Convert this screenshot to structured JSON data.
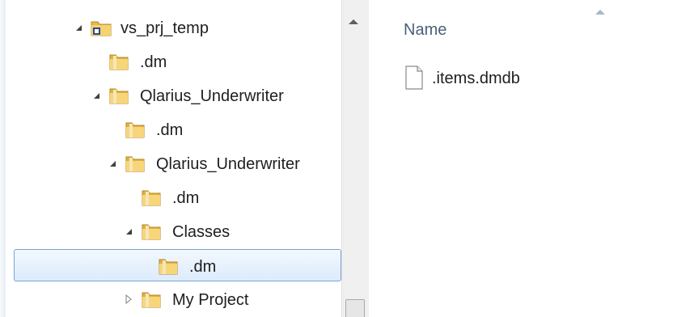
{
  "nav_tree": {
    "items": [
      {
        "label": "vs_prj_temp",
        "icon": "project-folder-icon",
        "expander": "expanded"
      },
      {
        "label": ".dm",
        "icon": "folder-icon",
        "expander": "none"
      },
      {
        "label": "Qlarius_Underwriter",
        "icon": "folder-icon",
        "expander": "expanded"
      },
      {
        "label": ".dm",
        "icon": "folder-icon",
        "expander": "none"
      },
      {
        "label": "Qlarius_Underwriter",
        "icon": "folder-icon",
        "expander": "expanded"
      },
      {
        "label": ".dm",
        "icon": "folder-icon",
        "expander": "none"
      },
      {
        "label": "Classes",
        "icon": "folder-icon",
        "expander": "expanded"
      },
      {
        "label": ".dm",
        "icon": "folder-icon",
        "expander": "none",
        "selected": true
      },
      {
        "label": "My Project",
        "icon": "folder-icon",
        "expander": "collapsed"
      }
    ]
  },
  "file_list": {
    "columns": [
      "Name"
    ],
    "sort": "ascending",
    "files": [
      {
        "name": ".items.dmdb",
        "icon": "file-icon"
      }
    ]
  },
  "colors": {
    "selection_bg": "#dcebfc",
    "selection_border": "#7da2ce",
    "header_text": "#4c607a",
    "folder_yellow": "#f2c94c"
  }
}
